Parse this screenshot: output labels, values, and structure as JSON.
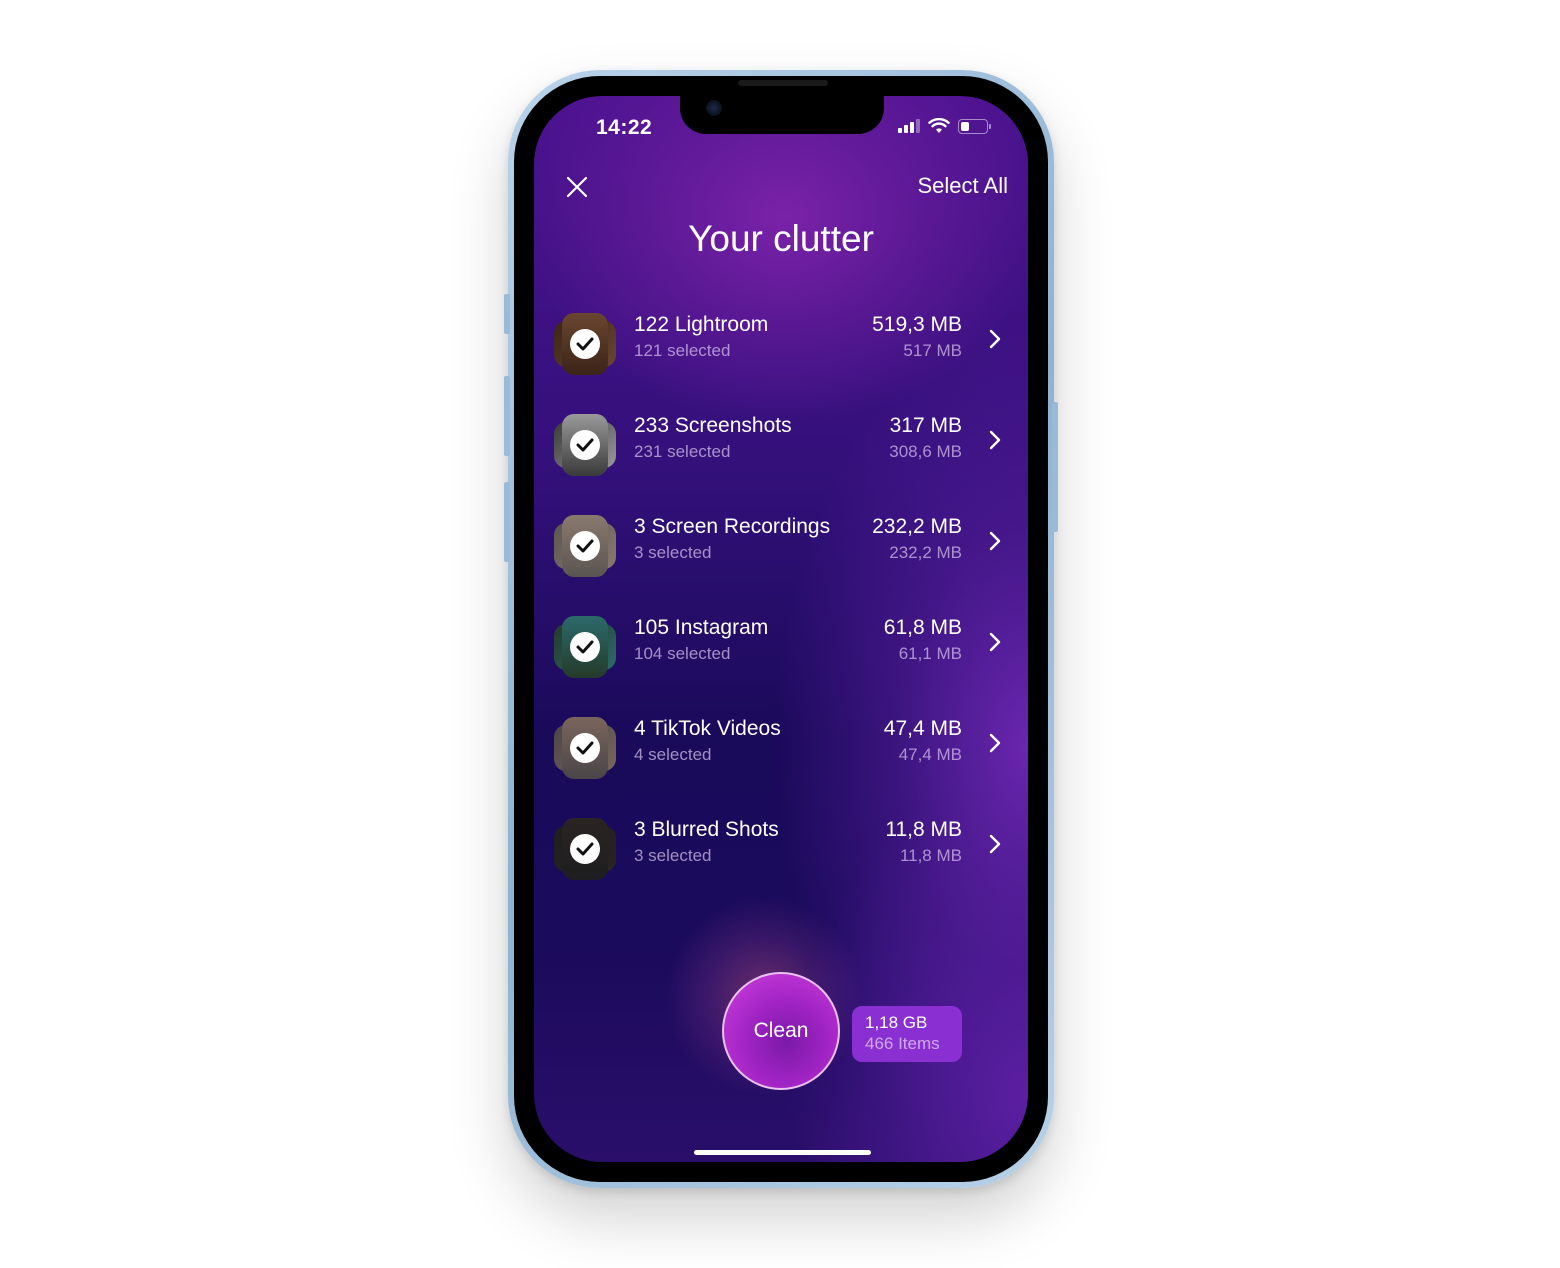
{
  "status_bar": {
    "time": "14:22",
    "battery_level": 0.35
  },
  "header": {
    "close_icon": "close-icon",
    "select_all_label": "Select All",
    "title": "Your clutter"
  },
  "categories": [
    {
      "name": "122 Lightroom",
      "selected": "121 selected",
      "size": "519,3 MB",
      "selected_size": "517 MB",
      "thumb_colors": [
        "#3b2418",
        "#6a4630"
      ]
    },
    {
      "name": "233 Screenshots",
      "selected": "231 selected",
      "size": "317 MB",
      "selected_size": "308,6 MB",
      "thumb_colors": [
        "#3a3a3a",
        "#9a9a9a"
      ]
    },
    {
      "name": "3 Screen Recordings",
      "selected": "3 selected",
      "size": "232,2 MB",
      "selected_size": "232,2 MB",
      "thumb_colors": [
        "#5a5552",
        "#8a7a6e"
      ]
    },
    {
      "name": "105 Instagram",
      "selected": "104 selected",
      "size": "61,8 MB",
      "selected_size": "61,1 MB",
      "thumb_colors": [
        "#253a2a",
        "#2c6a6a"
      ]
    },
    {
      "name": "4 TikTok Videos",
      "selected": "4 selected",
      "size": "47,4 MB",
      "selected_size": "47,4 MB",
      "thumb_colors": [
        "#4a4548",
        "#7a665c"
      ]
    },
    {
      "name": "3 Blurred Shots",
      "selected": "3 selected",
      "size": "11,8 MB",
      "selected_size": "11,8 MB",
      "thumb_colors": [
        "#1e1e20",
        "#2a2422"
      ]
    }
  ],
  "footer": {
    "clean_label": "Clean",
    "total_size": "1,18 GB",
    "total_items": "466 Items"
  }
}
